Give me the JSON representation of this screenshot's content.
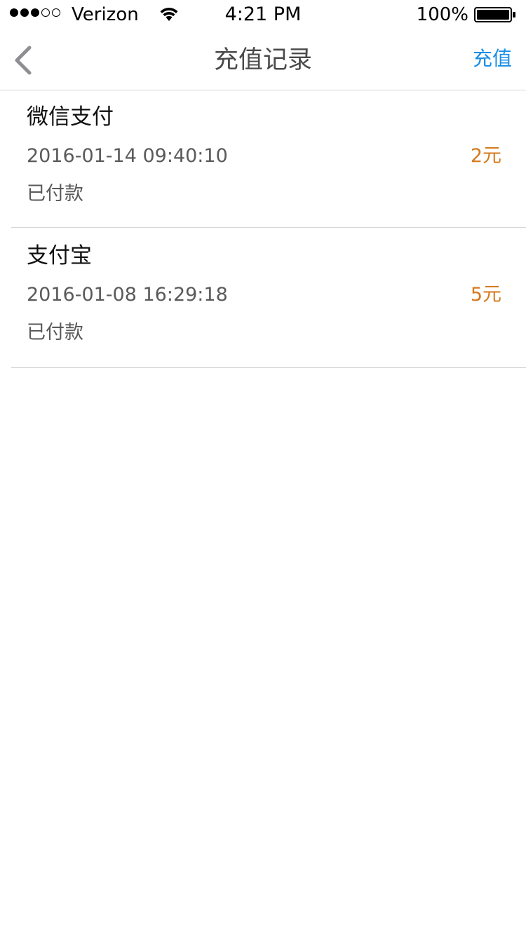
{
  "status_bar": {
    "carrier": "Verizon",
    "signal_bars_filled": 3,
    "signal_bars_total": 5,
    "time": "4:21 PM",
    "battery_percent": "100%"
  },
  "nav": {
    "back_icon": "chevron-left-icon",
    "title": "充值记录",
    "action_label": "充值"
  },
  "colors": {
    "accent": "#1a8ee6",
    "amount": "#d57a1f",
    "secondary_text": "#5a5a5a",
    "divider": "#d6d6d6"
  },
  "records": [
    {
      "method": "微信支付",
      "datetime": "2016-01-14 09:40:10",
      "amount": "2元",
      "status": "已付款"
    },
    {
      "method": "支付宝",
      "datetime": "2016-01-08 16:29:18",
      "amount": "5元",
      "status": "已付款"
    }
  ]
}
